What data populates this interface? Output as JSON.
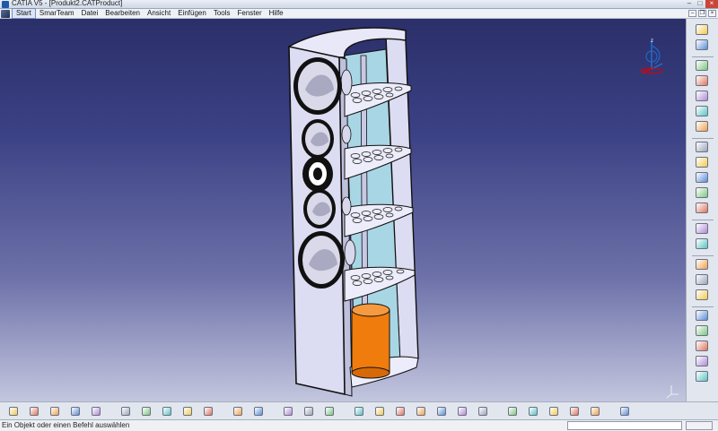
{
  "titlebar": {
    "title": "CATIA V5 - [Produkt2.CATProduct]"
  },
  "menubar": {
    "items": [
      {
        "label": "Start",
        "active": true
      },
      {
        "label": "SmarTeam"
      },
      {
        "label": "Datei"
      },
      {
        "label": "Bearbeiten"
      },
      {
        "label": "Ansicht"
      },
      {
        "label": "Einfügen"
      },
      {
        "label": "Tools"
      },
      {
        "label": "Fenster"
      },
      {
        "label": "Hilfe"
      }
    ]
  },
  "statusbar": {
    "message": "Ein Objekt oder einen Befehl auswählen",
    "command_input": ""
  },
  "colors": {
    "background_top": "#2b2f69",
    "background_bottom": "#c3c6de",
    "cabinet": "#dcdcf2",
    "cavity": "#a9d6e4",
    "cylinder": "#f07c0d",
    "shelf": "#ececfa"
  },
  "icons": {
    "right_toolbar": [
      "product-icon",
      "tree-icon",
      "component-icon",
      "part-icon",
      "move-icon",
      "constraint-icon",
      "snap-icon",
      "explode-icon",
      "clash-icon",
      "section-icon",
      "measure-icon",
      "catalog-icon",
      "material-icon",
      "bom-icon",
      "publish-icon",
      "scenes-icon",
      "enhanced-scene-icon",
      "annotation-icon",
      "view-icon",
      "grid-icon",
      "analyze-icon",
      "axis-icon"
    ],
    "bottom_toolbar": [
      "new-icon",
      "open-icon",
      "save-icon",
      "print-icon",
      "cut-icon",
      "copy-icon",
      "paste-icon",
      "undo-icon",
      "redo-icon",
      "help-icon",
      "formula-icon",
      "comment-icon",
      "table-icon",
      "lock-icon",
      "fly-icon",
      "fit-all-icon",
      "pan-icon",
      "rotate-icon",
      "zoom-in-icon",
      "zoom-out-icon",
      "normal-view-icon",
      "iso-view-icon",
      "hide-show-icon",
      "swap-icon",
      "shading-icon",
      "render-icon",
      "material-icon",
      "catia-logo-icon"
    ]
  }
}
